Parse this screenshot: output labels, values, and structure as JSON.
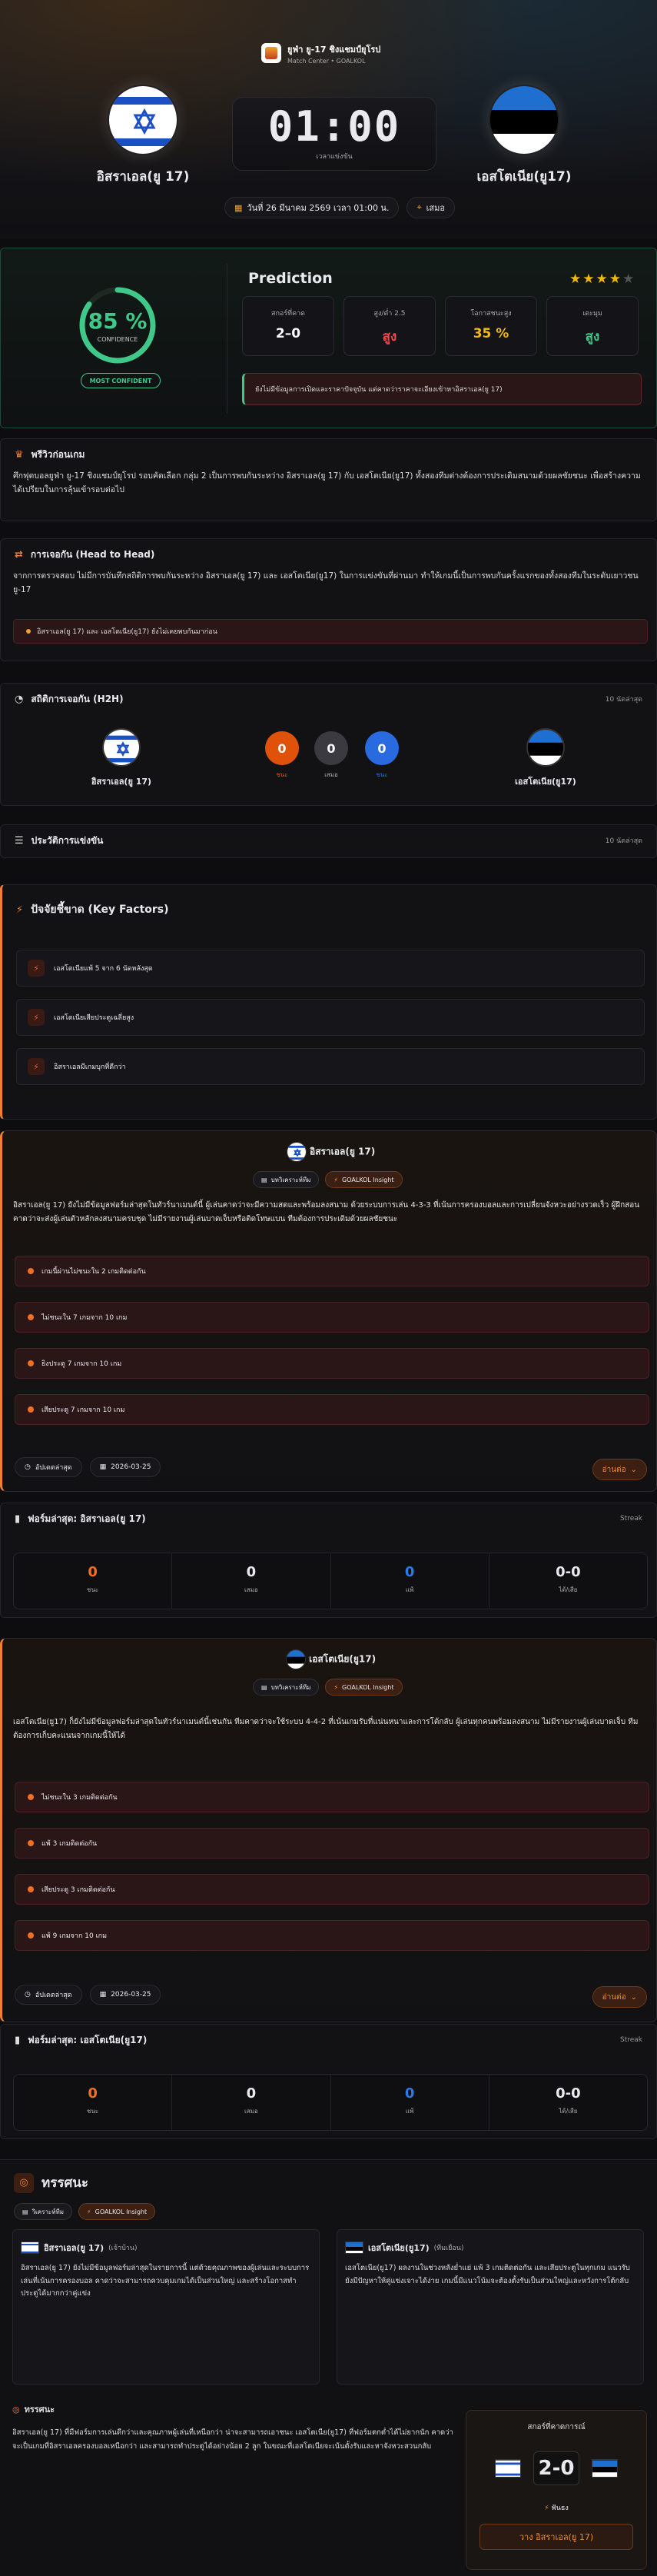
{
  "header": {
    "league": "ยูฟ่า ยู-17 ชิงแชมป์ยุโรป",
    "sub": "Match Center • GOALKOL",
    "home": "อิสราเอล(ยู 17)",
    "away": "เอสโตเนีย(ยู17)",
    "time": "01:00",
    "time_label": "เวลาแข่งขัน",
    "date": "วันที่ 26 มีนาคม 2569 เวลา 01:00 น.",
    "venue": "เสมอ"
  },
  "prediction": {
    "confidence": "85 %",
    "confidence_label": "CONFIDENCE",
    "confidence_value": 85,
    "badge": "MOST CONFIDENT",
    "title": "Prediction",
    "stars": 4,
    "stars_max": 5,
    "stats": [
      {
        "label": "สกอร์ที่คาด",
        "value": "2–0",
        "color": "#ffffff"
      },
      {
        "label": "สูง/ต่ำ 2.5",
        "value": "สูง",
        "color": "#f04a4a"
      },
      {
        "label": "โอกาสชนะสูง",
        "value": "35 %",
        "color": "#f0b90b"
      },
      {
        "label": "เตะมุม",
        "value": "สูง",
        "color": "#3ec98a"
      }
    ],
    "note": "ยังไม่มีข้อมูลการเปิดและราคาปัจจุบัน แต่คาดว่าราคาจะเอียงเข้าหาอิสราเอล(ยู 17)"
  },
  "preview": {
    "title": "พรีวิวก่อนเกม",
    "text": "ศึกฟุตบอลยูฟ่า ยู-17 ชิงแชมป์ยุโรป รอบคัดเลือก กลุ่ม 2 เป็นการพบกันระหว่าง อิสราเอล(ยู 17) กับ เอสโตเนีย(ยู17) ทั้งสองทีมต่างต้องการประเดิมสนามด้วยผลชัยชนะ เพื่อสร้างความได้เปรียบในการลุ้นเข้ารอบต่อไป"
  },
  "h2h": {
    "title": "การเจอกัน (Head to Head)",
    "text": "จากการตรวจสอบ ไม่มีการบันทึกสถิติการพบกันระหว่าง อิสราเอล(ยู 17) และ เอสโตเนีย(ยู17) ในการแข่งขันที่ผ่านมา ทำให้เกมนี้เป็นการพบกันครั้งแรกของทั้งสองทีมในระดับเยาวชนยู-17",
    "item": "อิสราเอล(ยู 17) และ เอสโตเนีย(ยู17) ยังไม่เคยพบกันมาก่อน"
  },
  "h2hstats": {
    "title": "สถิติการเจอกัน (H2H)",
    "right": "10 นัดล่าสุด",
    "home": "อิสราเอล(ยู 17)",
    "away": "เอสโตเนีย(ยู17)",
    "win": "0",
    "draw": "0",
    "loss": "0",
    "win_label": "ชนะ",
    "draw_label": "เสมอ",
    "loss_label": "ชนะ"
  },
  "history": {
    "title": "ประวัติการแข่งขัน",
    "right": "10 นัดล่าสุด"
  },
  "keyfactors": {
    "title": "ปัจจัยชี้ขาด (Key Factors)",
    "items": [
      "เอสโตเนียแพ้ 5 จาก 6 นัดหลังสุด",
      "เอสโตเนียเสียประตูเฉลี่ยสูง",
      "อิสราเอลมีเกมบุกที่ดีกว่า"
    ]
  },
  "team1": {
    "name": "อิสราเอล(ยู 17)",
    "tag1": "บทวิเคราะห์ทีม",
    "tag2": "GOALKOL Insight",
    "text": "อิสราเอล(ยู 17) ยังไม่มีข้อมูลฟอร์มล่าสุดในทัวร์นาเมนต์นี้ ผู้เล่นคาดว่าจะมีความสดและพร้อมลงสนาม ด้วยระบบการเล่น 4-3-3 ที่เน้นการครองบอลและการเปลี่ยนจังหวะอย่างรวดเร็ว ผู้ฝึกสอนคาดว่าจะส่งผู้เล่นตัวหลักลงสนามครบชุด ไม่มีรายงานผู้เล่นบาดเจ็บหรือติดโทษแบน ทีมต้องการประเดิมด้วยผลชัยชนะ",
    "form": [
      "เกมนี้ผ่านไม่ชนะใน 2 เกมติดต่อกัน",
      "ไม่ชนะใน 7 เกมจาก 10 เกม",
      "ยิงประตู 7 เกมจาก 10 เกม",
      "เสียประตู 7 เกมจาก 10 เกม"
    ],
    "meta1": "อัปเดตล่าสุด",
    "meta2": "2026-03-25",
    "more": "อ่านต่อ"
  },
  "streak1": {
    "title": "ฟอร์มล่าสุด: อิสราเอล(ยู 17)",
    "right": "Streak",
    "win": "0",
    "draw": "0",
    "loss": "0",
    "score": "0-0",
    "labels": [
      "ชนะ",
      "เสมอ",
      "แพ้",
      "ได้/เสีย"
    ]
  },
  "team2": {
    "name": "เอสโตเนีย(ยู17)",
    "tag1": "บทวิเคราะห์ทีม",
    "tag2": "GOALKOL Insight",
    "text": "เอสโตเนีย(ยู17) ก็ยังไม่มีข้อมูลฟอร์มล่าสุดในทัวร์นาเมนต์นี้เช่นกัน ทีมคาดว่าจะใช้ระบบ 4-4-2 ที่เน้นเกมรับที่แน่นหนาและการโต้กลับ ผู้เล่นทุกคนพร้อมลงสนาม ไม่มีรายงานผู้เล่นบาดเจ็บ ทีมต้องการเก็บคะแนนจากเกมนี้ให้ได้",
    "form": [
      "ไม่ชนะใน 3 เกมติดต่อกัน",
      "แพ้ 3 เกมติดต่อกัน",
      "เสียประตู 3 เกมติดต่อกัน",
      "แพ้ 9 เกมจาก 10 เกม"
    ],
    "meta1": "อัปเดตล่าสุด",
    "meta2": "2026-03-25",
    "more": "อ่านต่อ"
  },
  "streak2": {
    "title": "ฟอร์มล่าสุด: เอสโตเนีย(ยู17)",
    "right": "Streak",
    "win": "0",
    "draw": "0",
    "loss": "0",
    "score": "0-0",
    "labels": [
      "ชนะ",
      "เสมอ",
      "แพ้",
      "ได้/เสีย"
    ]
  },
  "analysis": {
    "title": "ทรรศนะ",
    "tag1": "วิเคราะห์ทีม",
    "tag2": "GOALKOL Insight",
    "home_title": "อิสราเอล(ยู 17)",
    "home_sub": "(เจ้าบ้าน)",
    "home_text": "อิสราเอล(ยู 17) ยังไม่มีข้อมูลฟอร์มล่าสุดในรายการนี้ แต่ด้วยคุณภาพของผู้เล่นและระบบการเล่นที่เน้นการครองบอล คาดว่าจะสามารถควบคุมเกมได้เป็นส่วนใหญ่ และสร้างโอกาสทำประตูได้มากกว่าคู่แข่ง",
    "away_title": "เอสโตเนีย(ยู17)",
    "away_sub": "(ทีมเยือน)",
    "away_text": "เอสโตเนีย(ยู17) ผลงานในช่วงหลังย่ำแย่ แพ้ 3 เกมติดต่อกัน และเสียประตูในทุกเกม แนวรับยังมีปัญหาให้คู่แข่งเจาะได้ง่าย เกมนี้มีแนวโน้มจะต้องตั้งรับเป็นส่วนใหญ่และหวังการโต้กลับ",
    "summary_title": "ทรรศนะ",
    "summary": "อิสราเอล(ยู 17) ที่มีฟอร์มการเล่นดีกว่าและคุณภาพผู้เล่นที่เหนือกว่า น่าจะสามารถเอาชนะ เอสโตเนีย(ยู17) ที่ฟอร์มตกต่ำได้ไม่ยากนัก คาดว่าจะเป็นเกมที่อิสราเอลครองบอลเหนือกว่า และสามารถทำประตูได้อย่างน้อย 2 ลูก ในขณะที่เอสโตเนียจะเน้นตั้งรับและหาจังหวะสวนกลับ",
    "predict_label": "สกอร์ที่คาดการณ์",
    "home_score": "2",
    "away_score": "0",
    "conf": "ฟันธง",
    "bet": "วาง อิสราเอล(ยู 17)"
  }
}
